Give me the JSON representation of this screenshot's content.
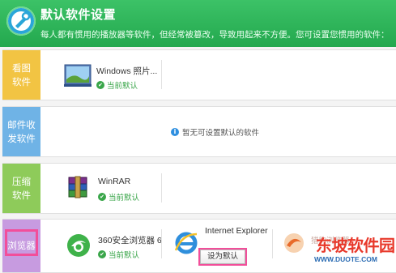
{
  "header": {
    "title": "默认软件设置",
    "subtitle": "每人都有惯用的播放器等软件，但经常被篡改，导致用起来不方便。您可设置您惯用的软件："
  },
  "rows": [
    {
      "category": "看图\n软件",
      "color": "#f2c443",
      "apps": [
        {
          "name": "Windows 照片...",
          "status": "当前默认",
          "icon": "windows-photo-viewer-icon"
        }
      ]
    },
    {
      "category": "邮件收\n发软件",
      "color": "#6fb3e6",
      "notice": "暂无可设置默认的软件"
    },
    {
      "category": "压缩\n软件",
      "color": "#8ecb5a",
      "apps": [
        {
          "name": "WinRAR",
          "status": "当前默认",
          "icon": "winrar-icon"
        }
      ]
    },
    {
      "category": "浏览器",
      "color": "#c79be0",
      "apps": [
        {
          "name": "360安全浏览器 6",
          "status": "当前默认",
          "icon": "360-browser-icon"
        },
        {
          "name": "Internet Explorer",
          "action": "设为默认",
          "icon": "internet-explorer-icon"
        },
        {
          "name": "猎豹浏览器",
          "icon": "liebao-browser-icon"
        }
      ]
    }
  ],
  "watermark": {
    "title": "东坡软件园",
    "url": "WWW.DUOTE.COM"
  },
  "colors": {
    "accent_green": "#27ae52",
    "highlight_pink": "#f24e9a"
  }
}
